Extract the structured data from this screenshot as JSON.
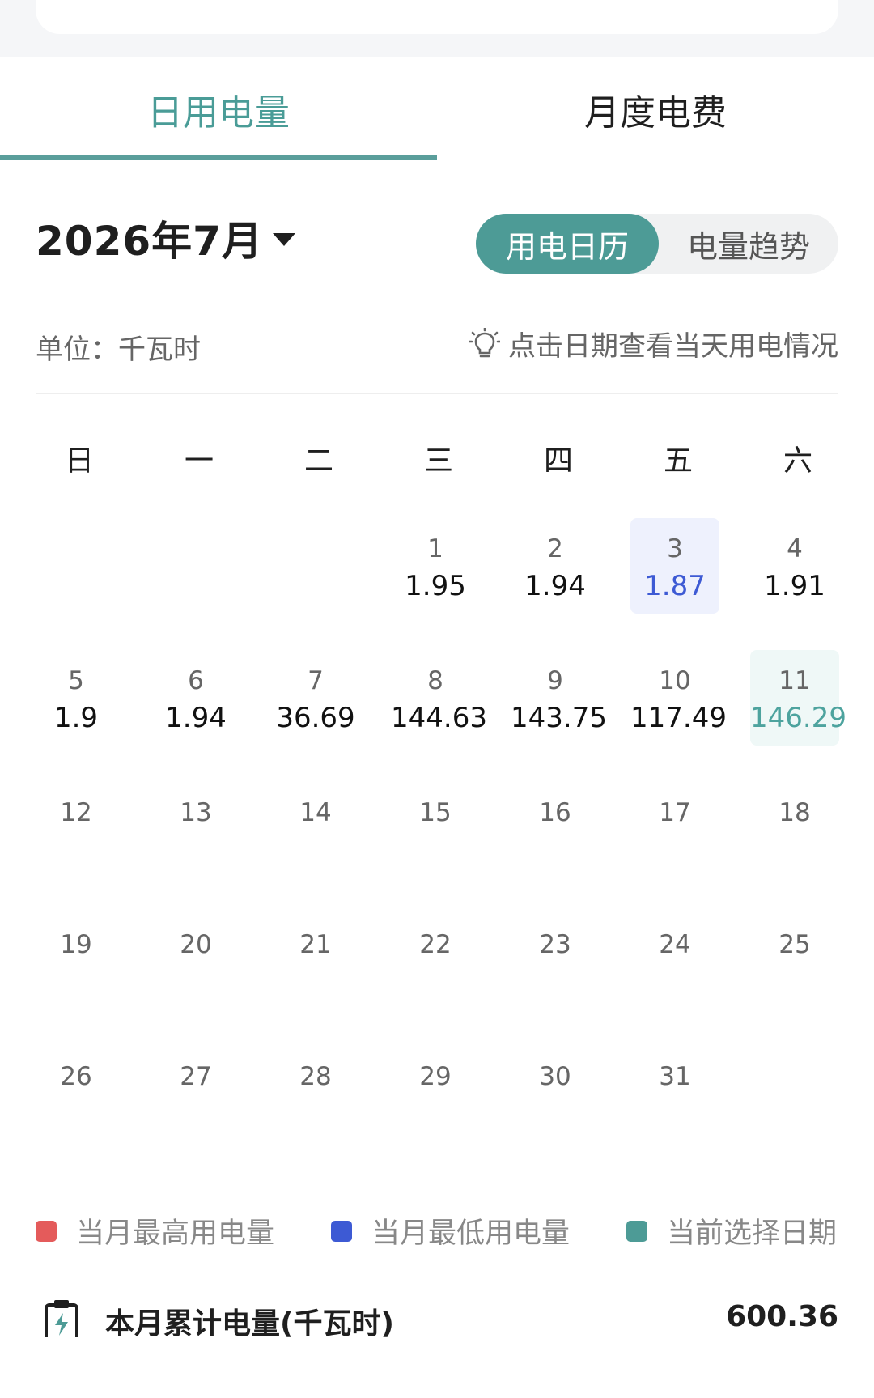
{
  "tabs": [
    {
      "label": "日用电量",
      "active": true
    },
    {
      "label": "月度电费",
      "active": false
    }
  ],
  "month_label": "2026年7月",
  "view_toggle": {
    "calendar": "用电日历",
    "trend": "电量趋势",
    "active": "calendar"
  },
  "unit_label": "单位：千瓦时",
  "tip_text": "点击日期查看当天用电情况",
  "weekdays": [
    "日",
    "一",
    "二",
    "三",
    "四",
    "五",
    "六"
  ],
  "days": [
    {
      "day": "1",
      "value": "1.95"
    },
    {
      "day": "2",
      "value": "1.94"
    },
    {
      "day": "3",
      "value": "1.87",
      "state": "lowest"
    },
    {
      "day": "4",
      "value": "1.91"
    },
    {
      "day": "5",
      "value": "1.9"
    },
    {
      "day": "6",
      "value": "1.94"
    },
    {
      "day": "7",
      "value": "36.69"
    },
    {
      "day": "8",
      "value": "144.63"
    },
    {
      "day": "9",
      "value": "143.75"
    },
    {
      "day": "10",
      "value": "117.49"
    },
    {
      "day": "11",
      "value": "146.29",
      "state": "selected"
    },
    {
      "day": "12",
      "value": ""
    },
    {
      "day": "13",
      "value": ""
    },
    {
      "day": "14",
      "value": ""
    },
    {
      "day": "15",
      "value": ""
    },
    {
      "day": "16",
      "value": ""
    },
    {
      "day": "17",
      "value": ""
    },
    {
      "day": "18",
      "value": ""
    },
    {
      "day": "19",
      "value": ""
    },
    {
      "day": "20",
      "value": ""
    },
    {
      "day": "21",
      "value": ""
    },
    {
      "day": "22",
      "value": ""
    },
    {
      "day": "23",
      "value": ""
    },
    {
      "day": "24",
      "value": ""
    },
    {
      "day": "25",
      "value": ""
    },
    {
      "day": "26",
      "value": ""
    },
    {
      "day": "27",
      "value": ""
    },
    {
      "day": "28",
      "value": ""
    },
    {
      "day": "29",
      "value": ""
    },
    {
      "day": "30",
      "value": ""
    },
    {
      "day": "31",
      "value": ""
    }
  ],
  "legend": [
    {
      "label": "当月最高用电量",
      "color": "#e45b5b"
    },
    {
      "label": "当月最低用电量",
      "color": "#3d5ad4"
    },
    {
      "label": "当前选择日期",
      "color": "#4d9b96"
    }
  ],
  "summary": {
    "label": "本月累计电量(千瓦时)",
    "value": "600.36",
    "icon": "clipboard-icon"
  },
  "colors": {
    "accent": "#4d9b96",
    "lowest": "#3d5ad4",
    "highest": "#e45b5b"
  }
}
